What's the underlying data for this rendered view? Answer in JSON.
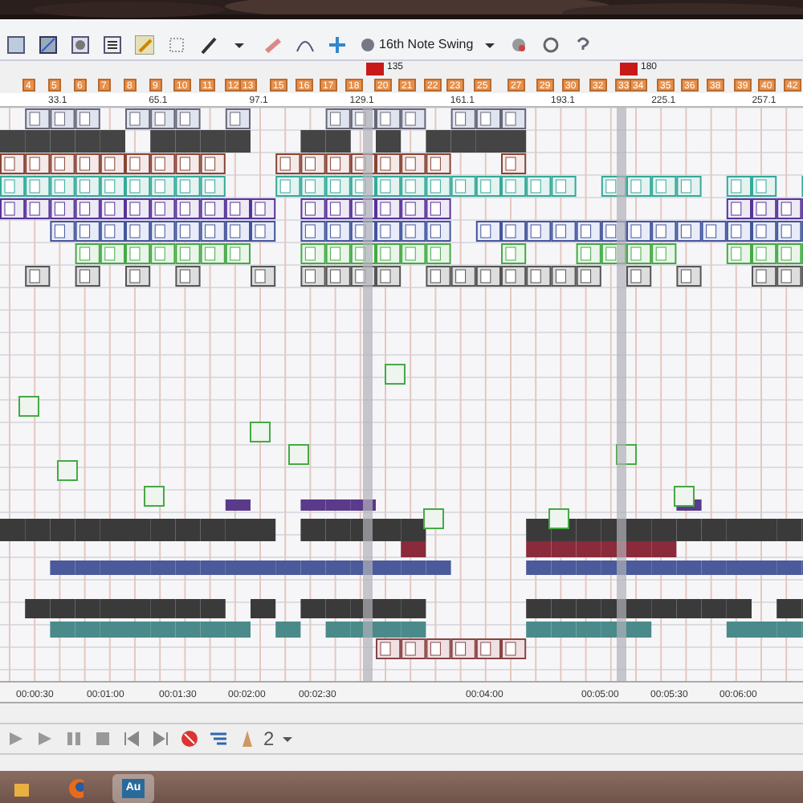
{
  "toolbar": {
    "swing": "16th Note Swing"
  },
  "tempo_markers": [
    {
      "label": "135"
    },
    {
      "label": "180"
    }
  ],
  "markers": [
    {
      "label": "4"
    },
    {
      "label": "5"
    },
    {
      "label": "6"
    },
    {
      "label": "7"
    },
    {
      "label": "8"
    },
    {
      "label": "9"
    },
    {
      "label": "10"
    },
    {
      "label": "11"
    },
    {
      "label": "12"
    },
    {
      "label": "13"
    },
    {
      "label": "15"
    },
    {
      "label": "16"
    },
    {
      "label": "17"
    },
    {
      "label": "18"
    },
    {
      "label": "20"
    },
    {
      "label": "21"
    },
    {
      "label": "22"
    },
    {
      "label": "23"
    },
    {
      "label": "25"
    },
    {
      "label": "27"
    },
    {
      "label": "29"
    },
    {
      "label": "30"
    },
    {
      "label": "32"
    },
    {
      "label": "33"
    },
    {
      "label": "34"
    },
    {
      "label": "35"
    },
    {
      "label": "36"
    },
    {
      "label": "38"
    },
    {
      "label": "39"
    },
    {
      "label": "40"
    },
    {
      "label": "42"
    }
  ],
  "bar_ruler": [
    "33.1",
    "65.1",
    "97.1",
    "129.1",
    "161.1",
    "193.1",
    "225.1",
    "257.1"
  ],
  "time_ruler": [
    "00:00:30",
    "00:01:00",
    "00:01:30",
    "00:02:00",
    "00:02:30",
    "00:04:00",
    "00:05:00",
    "00:05:30",
    "00:06:00"
  ],
  "transport": {
    "count": "2"
  },
  "taskbar": {
    "apps": [
      {
        "kind": "folder",
        "selected": false
      },
      {
        "kind": "browser",
        "selected": false
      },
      {
        "kind": "audio",
        "selected": true
      }
    ],
    "app_label": "Au"
  }
}
